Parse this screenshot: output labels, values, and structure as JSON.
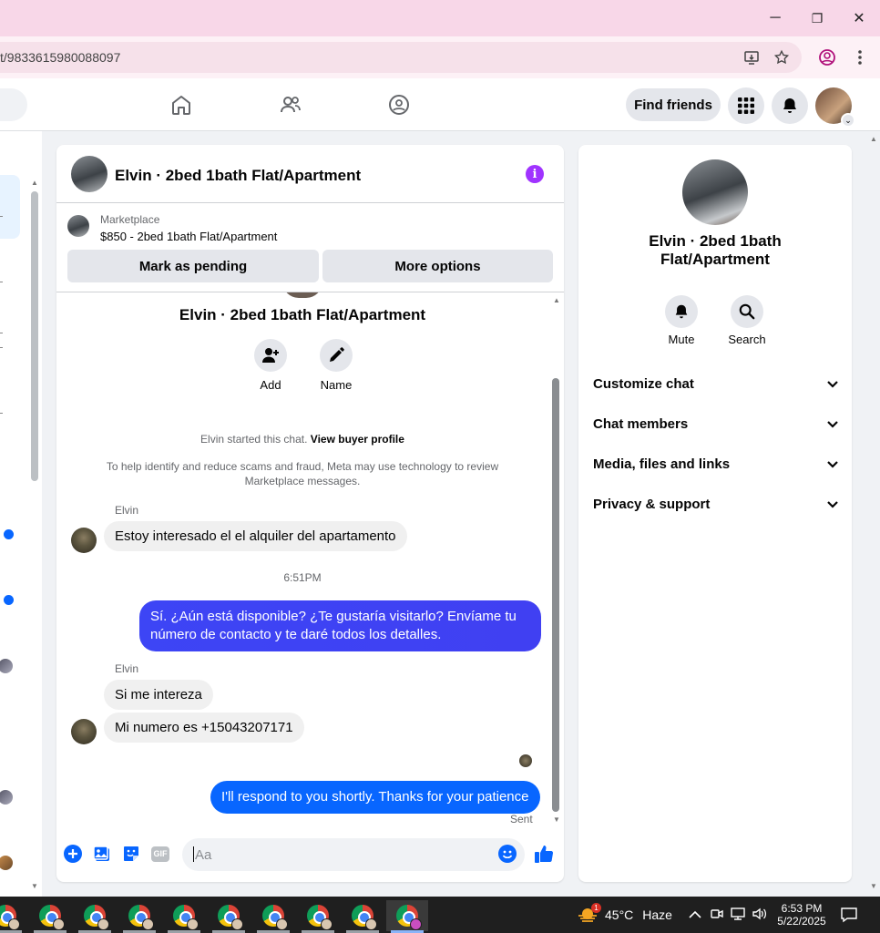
{
  "browser": {
    "url_fragment": "t/9833615980088097",
    "window_controls": {
      "minimize": "─",
      "maximize": "❐",
      "close": "✕"
    }
  },
  "fb_nav": {
    "find_friends": "Find friends"
  },
  "chat": {
    "header_title": "Elvin · 2bed 1bath Flat/Apartment",
    "marketplace_label": "Marketplace",
    "marketplace_listing": "$850 - 2bed 1bath Flat/Apartment",
    "mark_pending": "Mark as pending",
    "more_options": "More options",
    "intro_name": "Elvin · 2bed 1bath Flat/Apartment",
    "add_label": "Add",
    "name_label": "Name",
    "started_text": "Elvin started this chat.",
    "view_buyer_profile": "View buyer profile",
    "safety_notice": "To help identify and reduce scams and fraud, Meta may use technology to review Marketplace messages.",
    "messages": [
      {
        "sender": "Elvin",
        "text": "Estoy interesado el el alquiler del apartamento"
      },
      {
        "timestamp": "6:51PM"
      },
      {
        "sender": "me",
        "text": "Sí. ¿Aún está disponible? ¿Te gustaría visitarlo? Envíame tu número de contacto y te daré todos los detalles."
      },
      {
        "sender": "Elvin",
        "text": "Si me intereza"
      },
      {
        "sender": "Elvin",
        "text": "Mi numero es +15043207171"
      },
      {
        "sender": "me",
        "text": "I'll respond to you shortly. Thanks for your patience"
      }
    ],
    "sent_status": "Sent",
    "composer_placeholder": "Aa",
    "gif_label": "GIF"
  },
  "info_panel": {
    "name": "Elvin · 2bed 1bath Flat/Apartment",
    "mute": "Mute",
    "search": "Search",
    "sections": [
      "Customize chat",
      "Chat members",
      "Media, files and links",
      "Privacy & support"
    ]
  },
  "taskbar": {
    "weather_temp": "45°C",
    "weather_desc": "Haze",
    "weather_badge": "1",
    "time": "6:53 PM",
    "date": "5/22/2025"
  },
  "colors": {
    "messenger_blue_start": "#a334fa",
    "messenger_blue_end": "#0866ff",
    "accent": "#0866ff"
  }
}
